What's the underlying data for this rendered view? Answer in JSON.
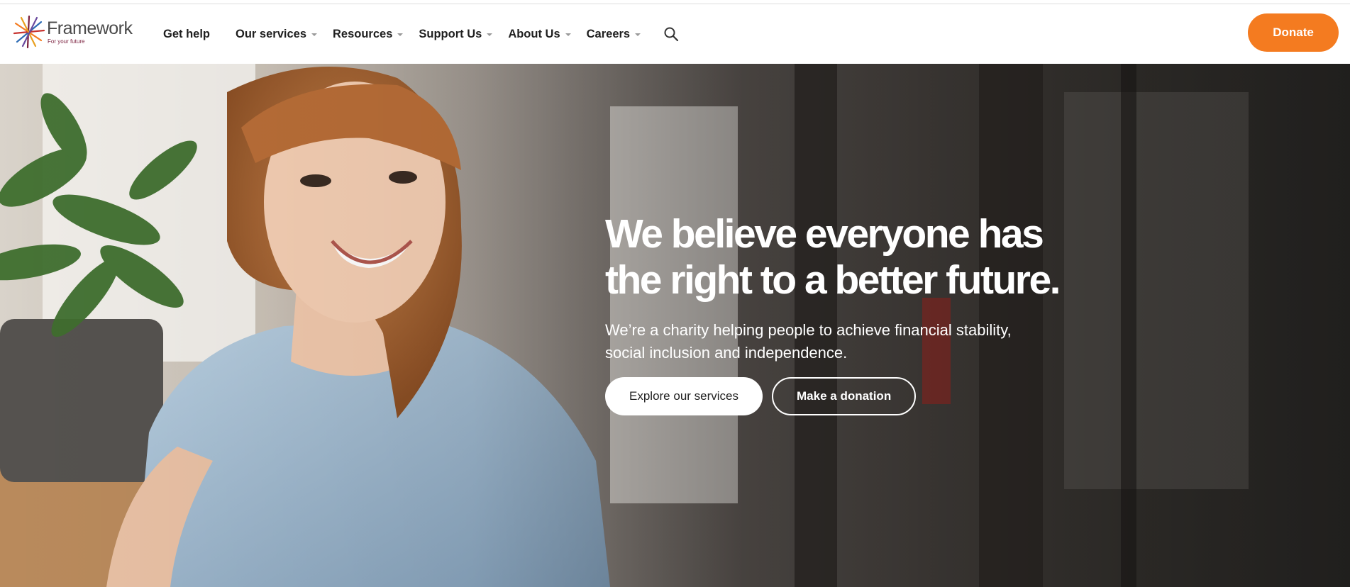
{
  "brand": {
    "name": "Framework",
    "tagline": "For your future",
    "accent": "#f47b20",
    "tagline_color": "#7a1f3d"
  },
  "nav": {
    "items": [
      {
        "label": "Get help",
        "has_dropdown": false
      },
      {
        "label": "Our services",
        "has_dropdown": true
      },
      {
        "label": "Resources",
        "has_dropdown": true
      },
      {
        "label": "Support Us",
        "has_dropdown": true
      },
      {
        "label": "About Us",
        "has_dropdown": true
      },
      {
        "label": "Careers",
        "has_dropdown": true
      }
    ],
    "search_icon": "search-icon",
    "donate_label": "Donate"
  },
  "hero": {
    "title": "We believe everyone has the right to a better future.",
    "subtitle": "We’re a charity helping people to achieve financial stability, social inclusion and independence.",
    "primary_button": "Explore our services",
    "secondary_button": "Make a donation"
  }
}
